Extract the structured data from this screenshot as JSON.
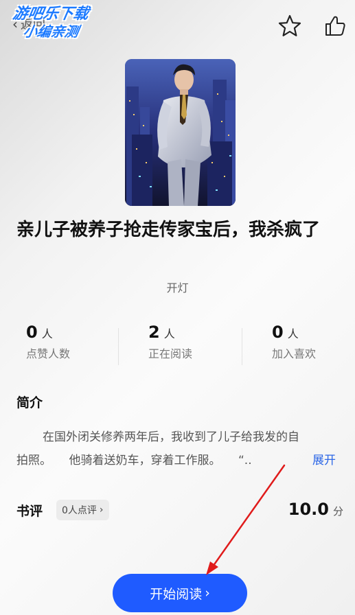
{
  "header": {
    "back_label": "返回",
    "watermark_line1": "游吧乐下载",
    "watermark_line2": "小编亲测",
    "star_icon": "star-outline-icon",
    "like_icon": "thumbs-up-outline-icon"
  },
  "book": {
    "title": "亲儿子被养子抢走传家宝后，我杀疯了",
    "author": "开灯"
  },
  "stats": [
    {
      "value": "0",
      "unit": "人",
      "label": "点赞人数"
    },
    {
      "value": "2",
      "unit": "人",
      "label": "正在阅读"
    },
    {
      "value": "0",
      "unit": "人",
      "label": "加入喜欢"
    }
  ],
  "intro": {
    "heading": "简介",
    "line1": "在国外闭关修养两年后，我收到了儿子给我发的自",
    "line2": "拍照。　　他骑着送奶车，穿着工作服。　　“..",
    "expand_label": "展开"
  },
  "review": {
    "title": "书评",
    "badge_label": "0人点评",
    "score_value": "10.0",
    "score_unit": "分"
  },
  "start_button": {
    "label": "开始阅读"
  },
  "colors": {
    "accent": "#1f5bff",
    "link": "#2b66e6",
    "annotation": "#e01b1b"
  }
}
